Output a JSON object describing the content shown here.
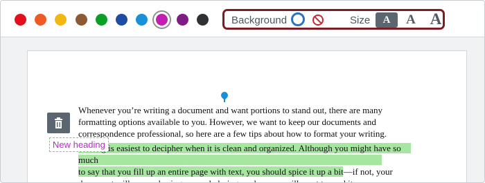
{
  "toolbar": {
    "colors": [
      {
        "name": "red",
        "hex": "#e0111d"
      },
      {
        "name": "orange",
        "hex": "#f05a24"
      },
      {
        "name": "yellow",
        "hex": "#f0b810"
      },
      {
        "name": "brown",
        "hex": "#8e5a34"
      },
      {
        "name": "green",
        "hex": "#0c9f28"
      },
      {
        "name": "dark-blue",
        "hex": "#1f4da5"
      },
      {
        "name": "light-blue",
        "hex": "#1891d9"
      },
      {
        "name": "magenta",
        "hex": "#c11fb3",
        "selected": true
      },
      {
        "name": "purple",
        "hex": "#7e1d84"
      },
      {
        "name": "dark-gray",
        "hex": "#2f3134"
      }
    ],
    "background_label": "Background",
    "size_label": "Size",
    "size_small": "A",
    "size_medium": "A",
    "size_large": "A",
    "highlight_outline_color": "#7d1c23"
  },
  "document": {
    "paragraph_1": "Whenever you’re writing a document and want portions to stand out, there are many formatting options available to you. However, we want to keep our documents and correspondence professional, so here are a few tips about how to format your writing.",
    "paragraph_2_line_1": "Writing is easiest to decipher when it is clean and organized. Although you might have so much",
    "paragraph_2_line_2": "to say that you fill up an entire page with text, you should spice it up a bit—if not, your",
    "paragraph_2_line_3": "document will appear boring, overwhelming, and no one will want to read it.",
    "highlight_color": "#a6e6a1"
  },
  "heading_tool": {
    "new_heading_label": "New heading",
    "icon": "trash-icon"
  }
}
